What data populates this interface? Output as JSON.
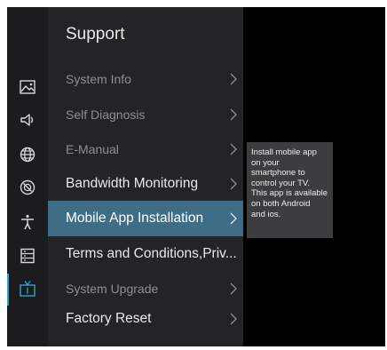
{
  "menu": {
    "title": "Support",
    "items": [
      {
        "label": "System Info",
        "chevron": true
      },
      {
        "label": "Self Diagnosis",
        "chevron": true
      },
      {
        "label": "E-Manual",
        "chevron": true
      },
      {
        "label": "Bandwidth Monitoring",
        "chevron": true
      },
      {
        "label": "Mobile App Installation",
        "chevron": true,
        "selected": true
      },
      {
        "label": "Terms and Conditions,Priv...",
        "chevron": false
      },
      {
        "label": "System Upgrade",
        "chevron": true
      },
      {
        "label": "Factory Reset",
        "chevron": true
      }
    ]
  },
  "tooltip": {
    "lines": [
      "Install mobile app",
      "on your",
      "smartphone to",
      "control your TV.",
      "This app is available",
      "on both Android",
      "and ios."
    ]
  },
  "rail": {
    "icons": [
      "picture-icon",
      "sound-icon",
      "network-globe-icon",
      "general-settings-icon",
      "accessibility-icon",
      "list-icon",
      "support-tv-icon"
    ],
    "active": "support-tv-icon"
  },
  "colors": {
    "selection": "#3e6d85",
    "accent": "#2fa4c9",
    "tooltip_bg": "#3d3d40"
  }
}
